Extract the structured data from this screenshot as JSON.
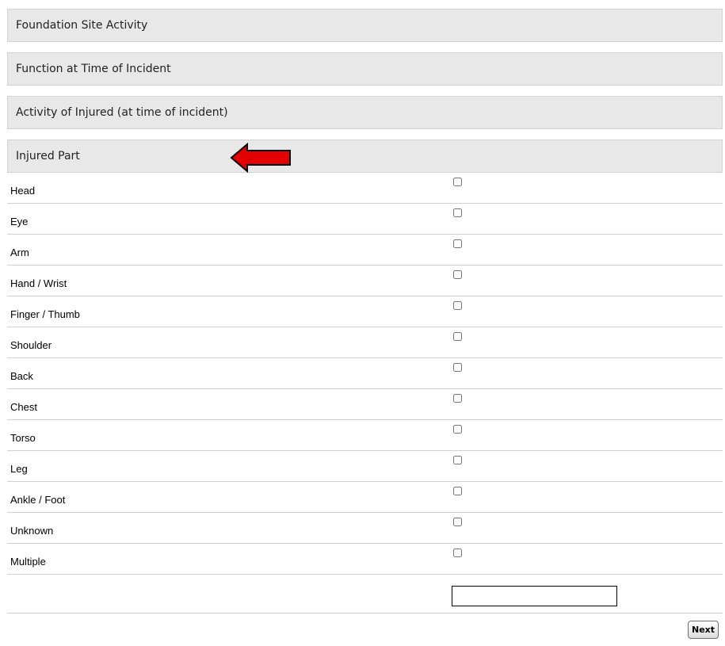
{
  "sections": [
    {
      "title": "Foundation Site Activity"
    },
    {
      "title": "Function at Time of Incident"
    },
    {
      "title": "Activity of Injured (at time of incident)"
    },
    {
      "title": "Injured Part"
    }
  ],
  "injured_part_options": [
    {
      "label": "Head",
      "checked": false
    },
    {
      "label": "Eye",
      "checked": false
    },
    {
      "label": "Arm",
      "checked": false
    },
    {
      "label": "Hand / Wrist",
      "checked": false
    },
    {
      "label": "Finger / Thumb",
      "checked": false
    },
    {
      "label": "Shoulder",
      "checked": false
    },
    {
      "label": "Back",
      "checked": false
    },
    {
      "label": "Chest",
      "checked": false
    },
    {
      "label": "Torso",
      "checked": false
    },
    {
      "label": "Leg",
      "checked": false
    },
    {
      "label": "Ankle / Foot",
      "checked": false
    },
    {
      "label": "Unknown",
      "checked": false
    },
    {
      "label": "Multiple",
      "checked": false
    }
  ],
  "other_field": {
    "value": ""
  },
  "buttons": {
    "next_label": "Next"
  },
  "annotation": {
    "arrow_color": "#e30000",
    "arrow_icon": "left-arrow-icon"
  }
}
